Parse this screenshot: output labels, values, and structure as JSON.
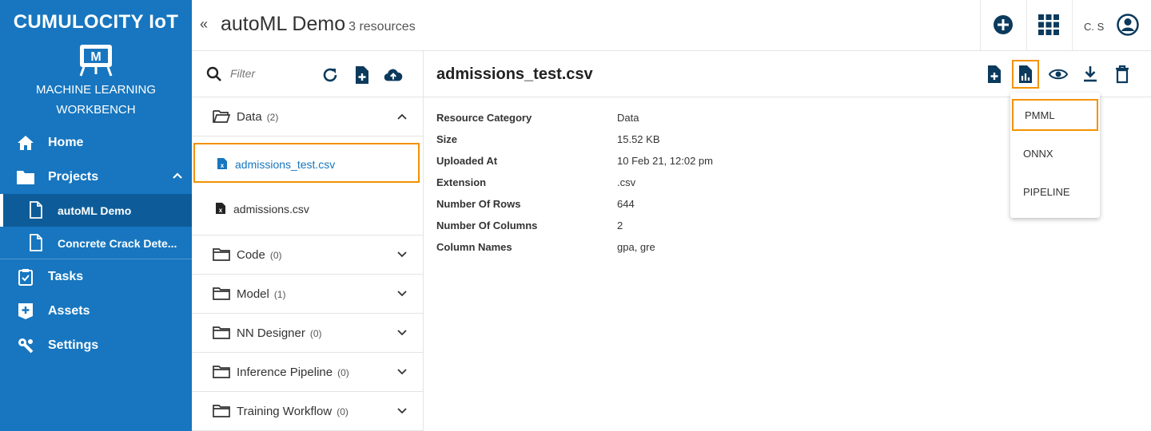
{
  "brand": {
    "name": "CUMULOCITY IoT",
    "app_line1": "MACHINE LEARNING",
    "app_line2": "WORKBENCH",
    "logo_letter": "M"
  },
  "nav": {
    "home": "Home",
    "projects": "Projects",
    "project_items": [
      "autoML Demo",
      "Concrete Crack Dete..."
    ],
    "tasks": "Tasks",
    "assets": "Assets",
    "settings": "Settings"
  },
  "header": {
    "collapse": "«",
    "title": "autoML Demo",
    "subtitle": "3 resources",
    "user": "C. S"
  },
  "filter": {
    "placeholder": "Filter"
  },
  "categories": {
    "data": {
      "name": "Data",
      "count": "(2)"
    },
    "code": {
      "name": "Code",
      "count": "(0)"
    },
    "model": {
      "name": "Model",
      "count": "(1)"
    },
    "nn": {
      "name": "NN Designer",
      "count": "(0)"
    },
    "inference": {
      "name": "Inference Pipeline",
      "count": "(0)"
    },
    "training": {
      "name": "Training Workflow",
      "count": "(0)"
    }
  },
  "files": [
    "admissions_test.csv",
    "admissions.csv"
  ],
  "detail": {
    "title": "admissions_test.csv",
    "props": [
      {
        "key": "Resource Category",
        "value": "Data"
      },
      {
        "key": "Size",
        "value": "15.52 KB"
      },
      {
        "key": "Uploaded At",
        "value": "10 Feb 21, 12:02 pm"
      },
      {
        "key": "Extension",
        "value": ".csv"
      },
      {
        "key": "Number Of Rows",
        "value": "644"
      },
      {
        "key": "Number Of Columns",
        "value": "2"
      },
      {
        "key": "Column Names",
        "value": "gpa, gre"
      }
    ]
  },
  "dropdown": [
    "PMML",
    "ONNX",
    "PIPELINE"
  ],
  "colors": {
    "sidebar": "#1776bf",
    "sidebar_active": "#0d5c99",
    "highlight": "#f39200",
    "icon_dark": "#0b3a5d"
  }
}
